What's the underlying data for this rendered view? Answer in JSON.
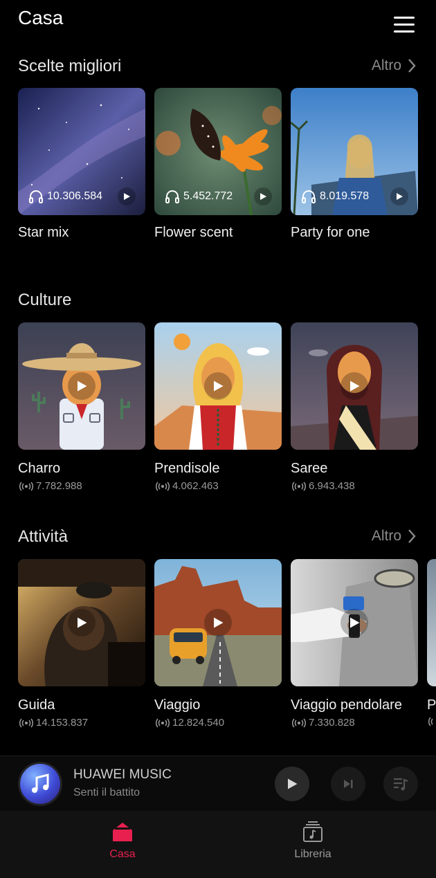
{
  "header": {
    "title": "Casa"
  },
  "sections": {
    "top_picks": {
      "title": "Scelte migliori",
      "more_label": "Altro",
      "items": [
        {
          "title": "Star mix",
          "plays": "10.306.584"
        },
        {
          "title": "Flower scent",
          "plays": "5.452.772"
        },
        {
          "title": "Party for one",
          "plays": "8.019.578"
        }
      ]
    },
    "culture": {
      "title": "Culture",
      "items": [
        {
          "title": "Charro",
          "listeners": "7.782.988"
        },
        {
          "title": "Prendisole",
          "listeners": "4.062.463"
        },
        {
          "title": "Saree",
          "listeners": "6.943.438"
        }
      ]
    },
    "activity": {
      "title": "Attività",
      "more_label": "Altro",
      "items": [
        {
          "title": "Guida",
          "listeners": "14.153.837"
        },
        {
          "title": "Viaggio",
          "listeners": "12.824.540"
        },
        {
          "title": "Viaggio pendolare",
          "listeners": "7.330.828"
        },
        {
          "title": "P",
          "listeners": ""
        }
      ]
    }
  },
  "player": {
    "title": "HUAWEI MUSIC",
    "subtitle": "Senti il battito"
  },
  "tabs": [
    {
      "label": "Casa",
      "active": true
    },
    {
      "label": "Libreria",
      "active": false
    }
  ],
  "colors": {
    "accent": "#e8204f",
    "inactive": "#9a9a9a"
  }
}
